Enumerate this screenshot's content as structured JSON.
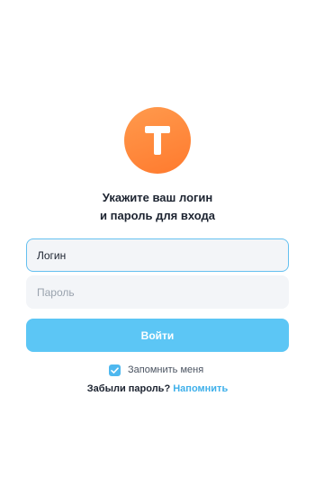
{
  "brand": {
    "logo_icon": "letter-t-logo-icon",
    "accent_color": "#ff8a3d"
  },
  "title": {
    "line1": "Укажите ваш логин",
    "line2": "и пароль для входа"
  },
  "login_field": {
    "value": "Логин",
    "placeholder": ""
  },
  "password_field": {
    "value": "",
    "placeholder": "Пароль"
  },
  "submit": {
    "label": "Войти",
    "color": "#5cc6f5"
  },
  "remember": {
    "checked": true,
    "label": "Запомнить меня",
    "icon": "checkmark-icon"
  },
  "forgot": {
    "text": "Забыли пароль?",
    "link": "Напомнить"
  }
}
